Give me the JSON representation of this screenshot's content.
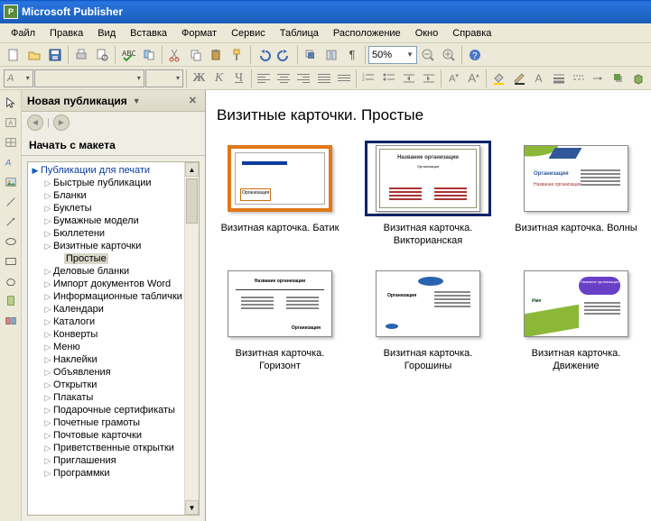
{
  "app_title": "Microsoft Publisher",
  "menubar": [
    {
      "label": "Файл",
      "u": 0
    },
    {
      "label": "Правка",
      "u": 0
    },
    {
      "label": "Вид",
      "u": 0
    },
    {
      "label": "Вставка",
      "u": 3
    },
    {
      "label": "Формат",
      "u": 1
    },
    {
      "label": "Сервис",
      "u": 0
    },
    {
      "label": "Таблица",
      "u": 0
    },
    {
      "label": "Расположение",
      "u": 0
    },
    {
      "label": "Окно",
      "u": 0
    },
    {
      "label": "Справка",
      "u": 0
    }
  ],
  "zoom": "50%",
  "task_pane": {
    "title": "Новая публикация",
    "section": "Начать с макета",
    "tree": {
      "root": "Публикации для печати",
      "items": [
        "Быстрые публикации",
        "Бланки",
        "Буклеты",
        "Бумажные модели",
        "Бюллетени",
        "Визитные карточки",
        "Деловые бланки",
        "Импорт документов Word",
        "Информационные таблички",
        "Календари",
        "Каталоги",
        "Конверты",
        "Меню",
        "Наклейки",
        "Объявления",
        "Открытки",
        "Плакаты",
        "Подарочные сертификаты",
        "Почетные грамоты",
        "Почтовые карточки",
        "Приветственные открытки",
        "Приглашения",
        "Программки"
      ],
      "sub_of": "Визитные карточки",
      "sub_label": "Простые"
    }
  },
  "content": {
    "title": "Визитные карточки. Простые",
    "templates": [
      {
        "label": "Визитная карточка. Батик"
      },
      {
        "label": "Визитная карточка. Викторианская",
        "selected": true
      },
      {
        "label": "Визитная карточка. Волны"
      },
      {
        "label": "Визитная карточка. Горизонт"
      },
      {
        "label": "Визитная карточка. Горошины"
      },
      {
        "label": "Визитная карточка. Движение"
      }
    ],
    "thumb_text": {
      "vict_title": "Название организации",
      "vict_sub": "Организация",
      "waves_org": "Организация",
      "horiz_title": "Название организации",
      "horiz_org": "Организация",
      "peas_org": "Организация",
      "move_sub": "Название организации"
    }
  }
}
